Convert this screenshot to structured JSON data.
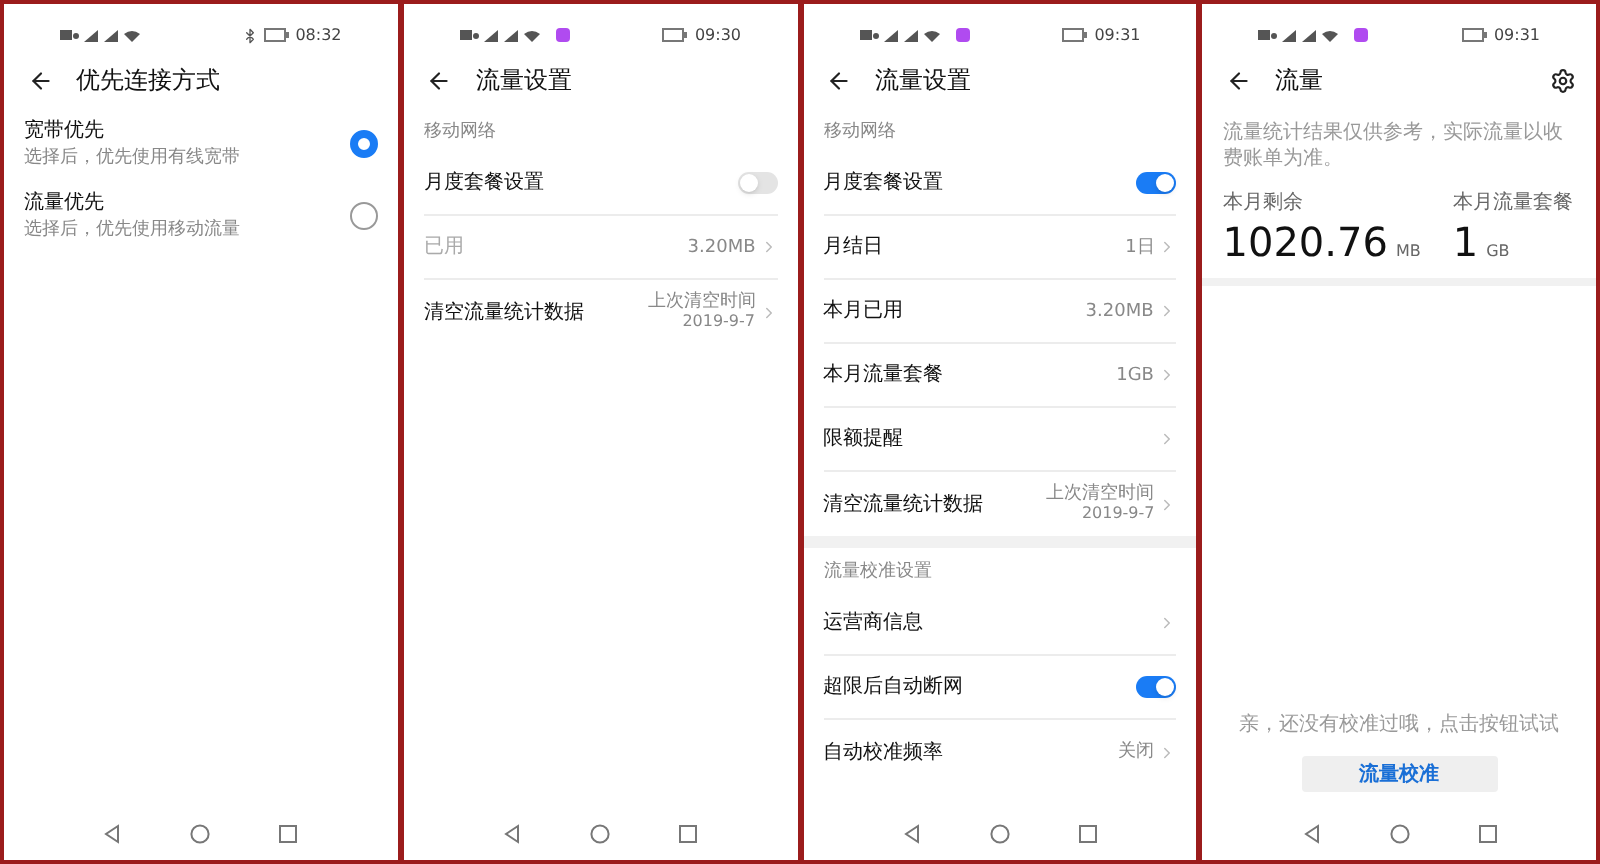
{
  "screens": [
    {
      "kind": "settings",
      "time": "08:32",
      "bluetooth": true,
      "app_badge": false,
      "title": "优先连接方式",
      "groups": [
        {
          "rows": [
            {
              "kind": "radio",
              "label": "宽带优先",
              "subtitle": "选择后，优先使用有线宽带",
              "selected": true
            },
            {
              "kind": "radio",
              "label": "流量优先",
              "subtitle": "选择后，优先使用移动流量",
              "selected": false
            }
          ]
        }
      ]
    },
    {
      "kind": "settings",
      "time": "09:30",
      "bluetooth": false,
      "app_badge": true,
      "title": "流量设置",
      "groups": [
        {
          "header": "移动网络",
          "rows": [
            {
              "kind": "toggle",
              "label": "月度套餐设置",
              "on": false
            },
            {
              "kind": "link",
              "label": "已用",
              "value": "3.20MB",
              "disabled": true
            },
            {
              "kind": "link",
              "label": "清空流量统计数据",
              "value": "上次清空时间",
              "value2": "2019-9-7",
              "disabled": false
            }
          ]
        }
      ]
    },
    {
      "kind": "settings",
      "time": "09:31",
      "bluetooth": false,
      "app_badge": true,
      "title": "流量设置",
      "groups": [
        {
          "header": "移动网络",
          "rows": [
            {
              "kind": "toggle",
              "label": "月度套餐设置",
              "on": true
            },
            {
              "kind": "link",
              "label": "月结日",
              "value": "1日",
              "disabled": false
            },
            {
              "kind": "link",
              "label": "本月已用",
              "value": "3.20MB",
              "disabled": false
            },
            {
              "kind": "link",
              "label": "本月流量套餐",
              "value": "1GB",
              "disabled": false
            },
            {
              "kind": "link",
              "label": "限额提醒",
              "disabled": false
            },
            {
              "kind": "link",
              "label": "清空流量统计数据",
              "value": "上次清空时间",
              "value2": "2019-9-7",
              "disabled": false
            }
          ]
        },
        {
          "header": "流量校准设置",
          "rows": [
            {
              "kind": "link",
              "label": "运营商信息",
              "disabled": false
            },
            {
              "kind": "toggle",
              "label": "超限后自动断网",
              "on": true
            },
            {
              "kind": "link",
              "label": "自动校准频率",
              "value": "关闭",
              "disabled": false
            }
          ]
        }
      ]
    },
    {
      "kind": "usage",
      "time": "09:31",
      "bluetooth": false,
      "app_badge": true,
      "title": "流量",
      "note": "流量统计结果仅供参考，实际流量以收费账单为准。",
      "stats": [
        {
          "label": "本月剩余",
          "value": "1020.76",
          "unit": "MB"
        },
        {
          "label": "本月流量套餐",
          "value": "1",
          "unit": "GB"
        }
      ],
      "message": "亲，还没有校准过哦，点击按钮试试",
      "button": "流量校准"
    }
  ]
}
